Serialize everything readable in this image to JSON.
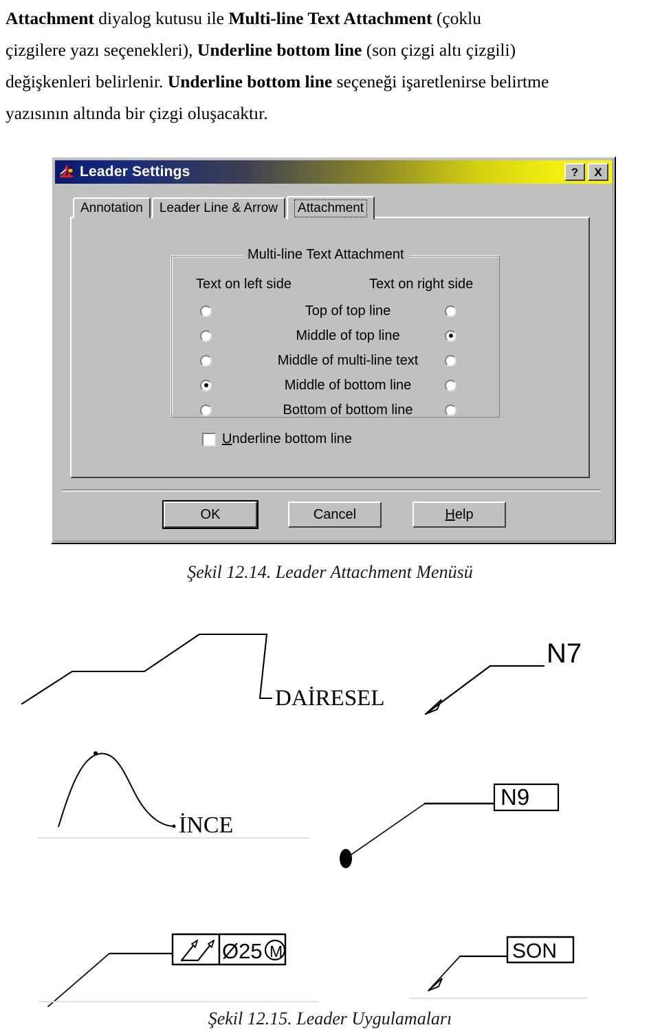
{
  "prose": {
    "line1": "Attachment diyalog kutusu ile Multi-line Text Attachment (çoklu",
    "line2": "çizgilere yazı seçenekleri), Underline bottom line (son çizgi altı çizgili)",
    "line3": "değişkenleri belirlenir. Underline bottom line seçeneği işaretlenirse belirtme",
    "line4": "yazısının altında bir çizgi oluşacaktır.",
    "bold_runs": [
      "Attachment",
      "Multi-line Text Attachment",
      "Underline bottom line"
    ]
  },
  "dialog": {
    "title": "Leader Settings",
    "icon": "autocad-a-icon",
    "help_button": "?",
    "close_button": "X",
    "tabs": [
      {
        "label": "Annotation",
        "active": false
      },
      {
        "label": "Leader Line & Arrow",
        "active": false
      },
      {
        "label": "Attachment",
        "active": true
      }
    ],
    "group": {
      "legend": "Multi-line Text Attachment",
      "column_headers": {
        "left": "Text on left side",
        "right": "Text on right side"
      },
      "options": [
        {
          "label": "Top of top line",
          "left_selected": false,
          "right_selected": false
        },
        {
          "label": "Middle of top line",
          "left_selected": false,
          "right_selected": true
        },
        {
          "label": "Middle of multi-line text",
          "left_selected": false,
          "right_selected": false
        },
        {
          "label": "Middle of bottom line",
          "left_selected": true,
          "right_selected": false
        },
        {
          "label": "Bottom of bottom line",
          "left_selected": false,
          "right_selected": false
        }
      ]
    },
    "checkbox": {
      "label_accel": "U",
      "label_rest": "nderline bottom line",
      "checked": false
    },
    "buttons": [
      {
        "label": "OK",
        "default": true
      },
      {
        "label": "Cancel",
        "default": false
      },
      {
        "label": "Help",
        "default": false,
        "accel": "H"
      }
    ]
  },
  "figures": {
    "caption_1": "Şekil 12.14. Leader Attachment Menüsü",
    "caption_2": "Şekil 12.15. Leader Uygulamaları",
    "drawings": [
      {
        "name": "leader-dairesel",
        "text": "DAİRESEL"
      },
      {
        "name": "leader-n7",
        "text": "N7"
      },
      {
        "name": "leader-ince",
        "text": "İNCE"
      },
      {
        "name": "leader-n9",
        "text": "N9"
      },
      {
        "name": "leader-dia25m",
        "text": "Ø25",
        "suffix": "M"
      },
      {
        "name": "leader-son",
        "text": "SON"
      }
    ]
  },
  "colors": {
    "dialog_face": "#c0c0c0",
    "title_start": "#0a1a6e",
    "title_end": "#f8f505",
    "title_text": "#ffffff",
    "ink": "#000000",
    "page": "#ffffff"
  }
}
